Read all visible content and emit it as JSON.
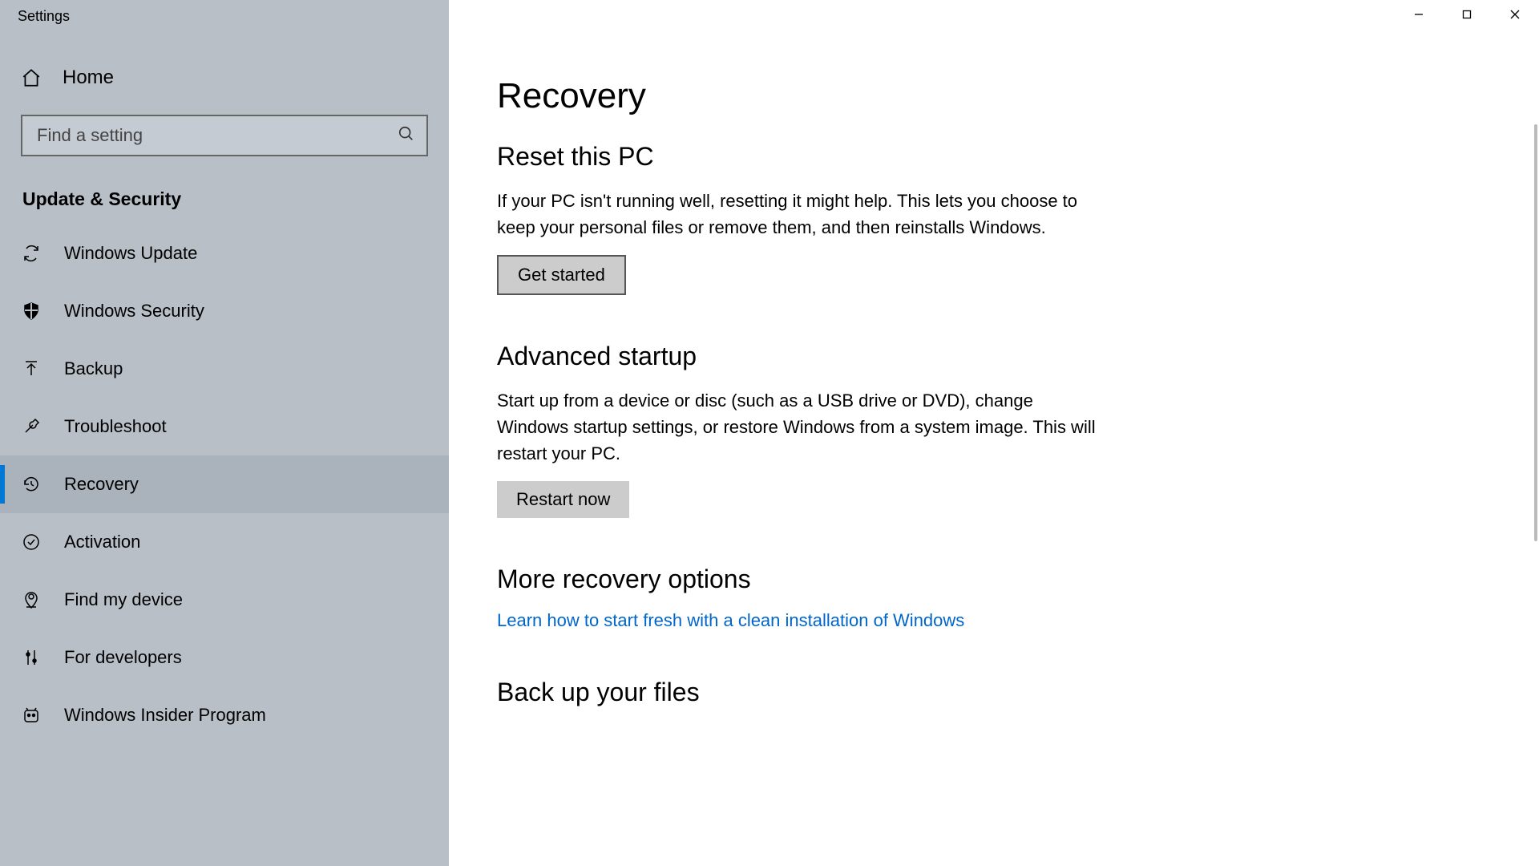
{
  "window": {
    "title": "Settings"
  },
  "sidebar": {
    "home_label": "Home",
    "search_placeholder": "Find a setting",
    "section_title": "Update & Security",
    "items": [
      {
        "id": "windows-update",
        "label": "Windows Update",
        "active": false
      },
      {
        "id": "windows-security",
        "label": "Windows Security",
        "active": false
      },
      {
        "id": "backup",
        "label": "Backup",
        "active": false
      },
      {
        "id": "troubleshoot",
        "label": "Troubleshoot",
        "active": false
      },
      {
        "id": "recovery",
        "label": "Recovery",
        "active": true
      },
      {
        "id": "activation",
        "label": "Activation",
        "active": false
      },
      {
        "id": "find-my-device",
        "label": "Find my device",
        "active": false
      },
      {
        "id": "for-developers",
        "label": "For developers",
        "active": false
      },
      {
        "id": "windows-insider",
        "label": "Windows Insider Program",
        "active": false
      }
    ]
  },
  "page": {
    "title": "Recovery",
    "reset": {
      "heading": "Reset this PC",
      "desc": "If your PC isn't running well, resetting it might help. This lets you choose to keep your personal files or remove them, and then reinstalls Windows.",
      "button": "Get started"
    },
    "advanced": {
      "heading": "Advanced startup",
      "desc": "Start up from a device or disc (such as a USB drive or DVD), change Windows startup settings, or restore Windows from a system image. This will restart your PC.",
      "button": "Restart now"
    },
    "more": {
      "heading": "More recovery options",
      "link": "Learn how to start fresh with a clean installation of Windows"
    },
    "backup": {
      "heading": "Back up your files"
    }
  },
  "colors": {
    "accent": "#0078d4",
    "link": "#0066cc",
    "sidebar_bg": "#b8bfc7"
  }
}
